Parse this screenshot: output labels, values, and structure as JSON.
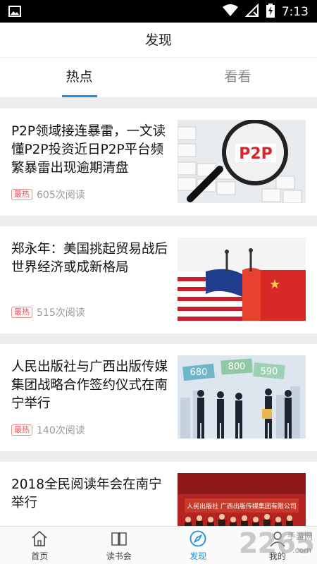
{
  "status_bar": {
    "time": "7:13",
    "icons": [
      "image-icon",
      "wifi-icon",
      "no-signal-icon",
      "battery-charging-icon"
    ]
  },
  "app_bar": {
    "title": "发现"
  },
  "tabs": [
    {
      "label": "热点",
      "active": true
    },
    {
      "label": "看看",
      "active": false
    }
  ],
  "feed": [
    {
      "title": "P2P领域接连暴雷，一文读懂P2P投资近日P2P平台频繁暴雷出现逾期清盘",
      "badge": "最热",
      "reads": "605次阅读",
      "image_text": "P2P"
    },
    {
      "title": "郑永年：美国挑起贸易战后世界经济或成新格局",
      "badge": "最热",
      "reads": "515次阅读"
    },
    {
      "title": "人民出版社与广西出版传媒集团战略合作签约仪式在南宁举行",
      "badge": "最热",
      "reads": "140次阅读",
      "image_numbers": [
        "680",
        "800",
        "590"
      ]
    },
    {
      "title": "2018全民阅读年会在南宁举行",
      "image_text": "人民出版社 广西出版传媒集团有限公司"
    }
  ],
  "bottom_nav": [
    {
      "label": "首页",
      "icon": "home-icon",
      "active": false
    },
    {
      "label": "读书会",
      "icon": "book-icon",
      "active": false
    },
    {
      "label": "发现",
      "icon": "compass-icon",
      "active": true
    },
    {
      "label": "我的",
      "icon": "user-icon",
      "active": false
    }
  ],
  "watermark": {
    "number": "2265",
    "site": "手游网",
    "sub": ".com"
  },
  "colors": {
    "accent": "#1a8fe0",
    "badge": "#e45a5a"
  }
}
